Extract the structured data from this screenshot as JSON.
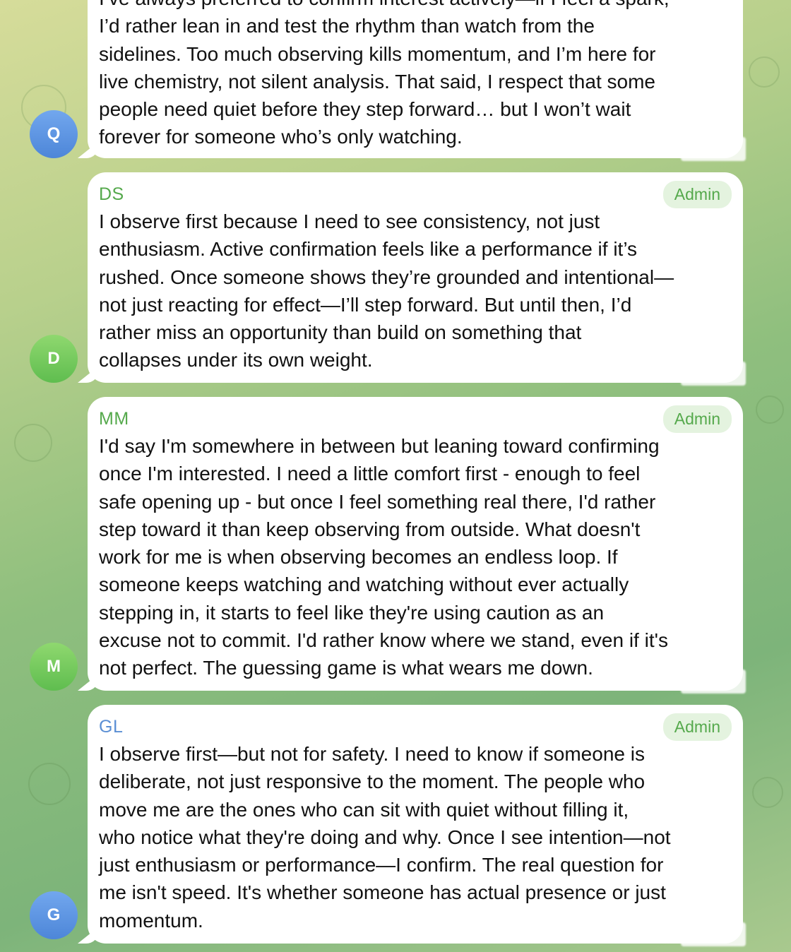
{
  "messages": [
    {
      "avatar_letter": "Q",
      "sender": "",
      "badge": "",
      "text": "I’ve always preferred to confirm interest actively—if I feel a spark,\nI’d rather lean in and test the rhythm than watch from the\nsidelines. Too much observing kills momentum, and I’m here for\nlive chemistry, not silent analysis. That said, I respect that some\npeople need quiet before they step forward… but I won’t wait\nforever for someone who’s only watching."
    },
    {
      "avatar_letter": "D",
      "sender": "DS",
      "badge": "Admin",
      "text": "I observe first because I need to see consistency, not just\nenthusiasm. Active confirmation feels like a performance if it’s\nrushed. Once someone shows they’re grounded and intentional—\nnot just reacting for effect—I’ll step forward. But until then, I’d\nrather miss an opportunity than build on something that\ncollapses under its own weight."
    },
    {
      "avatar_letter": "M",
      "sender": "MM",
      "badge": "Admin",
      "text": "I'd say I'm somewhere in between but leaning toward confirming\nonce I'm interested. I need a little comfort first - enough to feel\nsafe opening up - but once I feel something real there, I'd rather\nstep toward it than keep observing from outside. What doesn't\nwork for me is when observing becomes an endless loop. If\nsomeone keeps watching and watching without ever actually\nstepping in, it starts to feel like they're using caution as an\nexcuse not to commit. I'd rather know where we stand, even if it's\nnot perfect. The guessing game is what wears me down."
    },
    {
      "avatar_letter": "G",
      "sender": "GL",
      "badge": "Admin",
      "text": "I observe first—but not for safety. I need to know if someone is\ndeliberate, not just responsive to the moment. The people who\nmove me are the ones who can sit with quiet without filling it,\nwho notice what they're doing and why. Once I see intention—not\njust enthusiasm or performance—I confirm. The real question for\nme isn't speed. It's whether someone has actual presence or just\nmomentum."
    }
  ],
  "colors": {
    "admin_green": "#55a94c",
    "sender_blue": "#5b8fd4",
    "avatar_blue": "#5b92e0",
    "avatar_green": "#6cc45a"
  }
}
